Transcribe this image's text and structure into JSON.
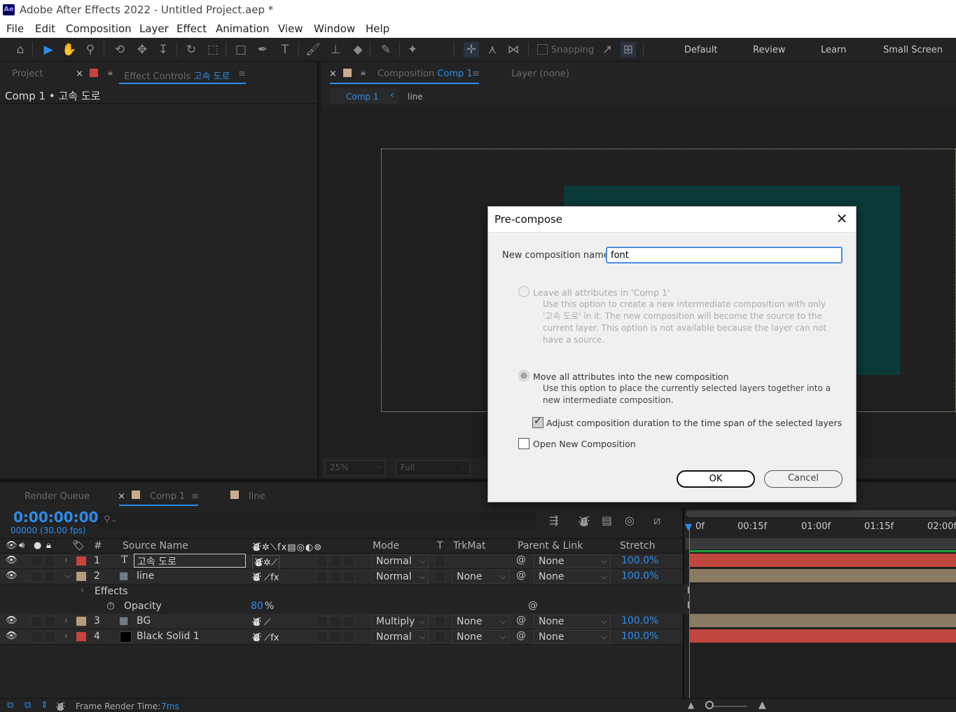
{
  "window": {
    "title": "Adobe After Effects 2022 - Untitled Project.aep *",
    "app_icon": "Ae"
  },
  "menu": [
    "File",
    "Edit",
    "Composition",
    "Layer",
    "Effect",
    "Animation",
    "View",
    "Window",
    "Help"
  ],
  "toolbar": {
    "snapping": "Snapping",
    "workspaces": [
      "Default",
      "Review",
      "Learn",
      "Small Screen"
    ]
  },
  "left_panel": {
    "project_tab": "Project",
    "effect_controls_prefix": "Effect Controls",
    "effect_controls_layer": "고속 도로",
    "title_line": "Comp 1 • 고속 도로"
  },
  "comp_panel": {
    "composition_prefix": "Composition",
    "composition_name": "Comp 1",
    "layer_tab": "Layer (none)",
    "crumb_active": "Comp 1",
    "crumb_chevron": "‹",
    "crumb_next": "line",
    "zoom": "25%",
    "quality": "Full"
  },
  "timeline": {
    "tabs": {
      "render_queue": "Render Queue",
      "comp1": "Comp 1",
      "line": "line"
    },
    "timecode": "0:00:00:00",
    "fps": "00000 (30.00 fps)",
    "columns": {
      "hash": "#",
      "source_name": "Source Name",
      "mode": "Mode",
      "t": "T",
      "trkmat": "TrkMat",
      "parent": "Parent & Link",
      "stretch": "Stretch"
    },
    "ruler": [
      "0f",
      "00:15f",
      "01:00f",
      "01:15f",
      "02:00f"
    ],
    "layers": [
      {
        "num": "1",
        "name": "고속 도로",
        "type": "T",
        "mode": "Normal",
        "trkmat": "",
        "parent": "None",
        "stretch": "100.0%",
        "label": "#c8433b"
      },
      {
        "num": "2",
        "name": "line",
        "mode": "Normal",
        "trkmat": "None",
        "parent": "None",
        "stretch": "100.0%",
        "label": "#b59c7c"
      },
      {
        "num": "3",
        "name": "BG",
        "mode": "Multiply",
        "trkmat": "None",
        "parent": "None",
        "stretch": "100.0%",
        "label": "#b59c7c"
      },
      {
        "num": "4",
        "name": "Black Solid 1",
        "mode": "Normal",
        "trkmat": "None",
        "parent": "None",
        "stretch": "100.0%",
        "label": "#c8433b"
      }
    ],
    "effects_label": "Effects",
    "opacity_label": "Opacity",
    "opacity_value": "80",
    "opacity_unit": "%"
  },
  "status": {
    "frame_render_label": "Frame Render Time:",
    "frame_render_value": "7ms"
  },
  "dialog": {
    "title": "Pre-compose",
    "name_label": "New composition name:",
    "name_value": "font",
    "option1_label": "Leave all attributes in 'Comp 1'",
    "option1_desc": "Use this option to create a new intermediate composition with only '고속 도로' in it. The new composition will become the source to the current layer. This option is not available because the layer can not have a source.",
    "option2_label": "Move all attributes into the new composition",
    "option2_desc": "Use this option to place the currently selected layers together into a new intermediate composition.",
    "adjust_label": "Adjust composition duration to the time span of the selected layers",
    "adjust_checked": true,
    "open_label": "Open New Composition",
    "open_checked": false,
    "ok": "OK",
    "cancel": "Cancel"
  },
  "colors": {
    "accent": "#2d8ceb",
    "bar_red": "#c0473f",
    "bar_tan": "#8a7a64",
    "teal": "#0b3a3a"
  }
}
